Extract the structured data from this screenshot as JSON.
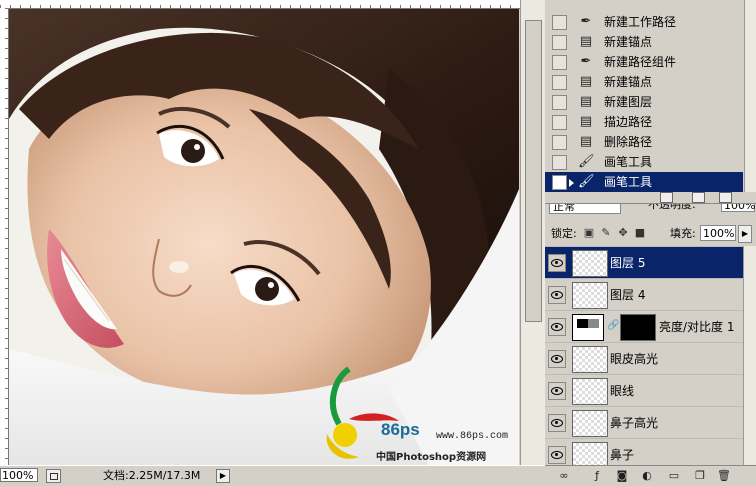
{
  "history": {
    "items": [
      {
        "label": "新建工作路径",
        "icon": "pen-icon"
      },
      {
        "label": "新建锚点",
        "icon": "document-icon"
      },
      {
        "label": "新建路径组件",
        "icon": "pen-icon"
      },
      {
        "label": "新建锚点",
        "icon": "document-icon"
      },
      {
        "label": "新建图层",
        "icon": "document-icon"
      },
      {
        "label": "描边路径",
        "icon": "document-icon"
      },
      {
        "label": "删除路径",
        "icon": "document-icon"
      },
      {
        "label": "画笔工具",
        "icon": "brush-icon"
      },
      {
        "label": "画笔工具",
        "icon": "brush-icon",
        "active": true
      }
    ]
  },
  "layers": {
    "blend_mode": "正常",
    "opacity_label": "不透明度:",
    "opacity_value": "100%",
    "lock_label": "锁定:",
    "fill_label": "填充:",
    "fill_value": "100%",
    "items": [
      {
        "name": "图层 5",
        "active": true
      },
      {
        "name": "图层 4"
      },
      {
        "name": "亮度/对比度 1",
        "adjustment": true
      },
      {
        "name": "眼皮高光"
      },
      {
        "name": "眼线"
      },
      {
        "name": "鼻子高光"
      },
      {
        "name": "鼻子"
      }
    ]
  },
  "status": {
    "zoom": "100%",
    "doc_size": "文档:2.25M/17.3M"
  },
  "watermark": {
    "brand": "86ps",
    "url": "www.86ps.com",
    "caption": "中国Photoshop资源网"
  },
  "colors": {
    "selection": "#0a246a",
    "panel": "#d4d0c8"
  }
}
